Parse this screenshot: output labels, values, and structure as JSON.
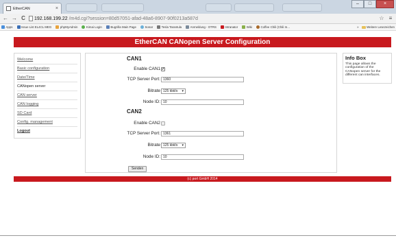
{
  "browser": {
    "tab_title": "EtherCAN",
    "tab_close": "×",
    "nav": {
      "back": "←",
      "forward": "→",
      "reload": "C"
    },
    "url_host": "192.168.199.22",
    "url_path": "/m4d.cgi?session=80d57051-afad-48a6-8907-90f0213a587d",
    "star": "☆",
    "menu": "≡",
    "window_controls": {
      "minimize": "–",
      "maximize": "□",
      "close": "×"
    }
  },
  "bookmarks": {
    "items": [
      {
        "label": "Apps",
        "color": "#4a8fdb"
      },
      {
        "label": "Issue List EL4CL MEG",
        "color": "#3b6fb6"
      },
      {
        "label": "phpMyAdmin",
        "color": "#e8a33d"
      },
      {
        "label": "Kimai Login",
        "color": "#59b04a"
      },
      {
        "label": "Bugzilla Main Page",
        "color": "#5a7fb8"
      },
      {
        "label": "Sonar",
        "color": "#6bb0d8"
      },
      {
        "label": "Tesla Tarantula",
        "color": "#777777"
      },
      {
        "label": "Anmeldung - OTRS",
        "color": "#7a8a9a"
      },
      {
        "label": "Intranator",
        "color": "#c8191e"
      },
      {
        "label": "Wiki",
        "color": "#8ab04a"
      },
      {
        "label": "Coffee Chili (Chili m...",
        "color": "#a86a2a"
      }
    ],
    "more": "»",
    "other": "Weitere Lesezeichen"
  },
  "page": {
    "banner": "EtherCAN CANopen Server Configuration",
    "menu": [
      "Welcome",
      "Basic configuration",
      "Date/Time",
      "CANopen server",
      "CAN server",
      "CAN logging",
      "SD Card",
      "Config. management",
      "Logout"
    ],
    "can1": {
      "title": "CAN1",
      "enable_label": "Enable CAN1",
      "enable_mark": "✔",
      "port_label": "TCP Server Port:",
      "port_value": "1360",
      "bitrate_label": "Bitrate",
      "bitrate_value": "125 kbit/s",
      "node_label": "Node ID:",
      "node_value": "10"
    },
    "can2": {
      "title": "CAN2",
      "enable_label": "Enable CAN2",
      "enable_mark": "",
      "port_label": "TCP Server Port:",
      "port_value": "1361",
      "bitrate_label": "Bitrate",
      "bitrate_value": "125 kbit/s",
      "node_label": "Node ID:",
      "node_value": "10"
    },
    "submit": "Senden",
    "dropdown_arrow": "▾",
    "info": {
      "title": "Info Box",
      "text": "This page allows the configuration of the CANopen server for the different can interfaces."
    },
    "footer": "(c) port GmbH 2014"
  },
  "colors": {
    "brand_red": "#c8191e"
  }
}
